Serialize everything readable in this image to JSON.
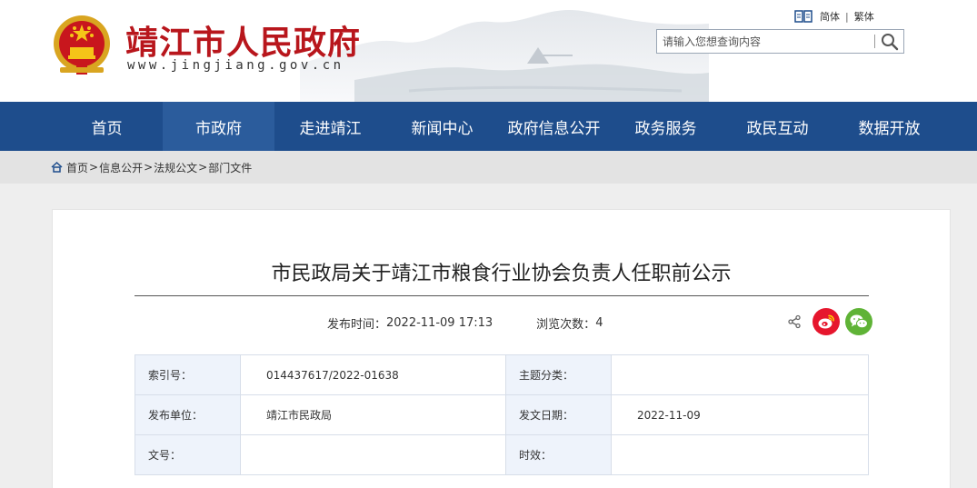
{
  "header": {
    "site_title": "靖江市人民政府",
    "site_url": "www.jingjiang.gov.cn",
    "lang_simplified": "简体",
    "lang_separator": "|",
    "lang_traditional": "繁体",
    "search_placeholder": "请输入您想查询内容"
  },
  "nav": {
    "items": [
      "首页",
      "市政府",
      "走进靖江",
      "新闻中心",
      "政府信息公开",
      "政务服务",
      "政民互动",
      "数据开放"
    ],
    "active_index": 1
  },
  "breadcrumb": {
    "items": [
      "首页",
      "信息公开",
      "法规公文",
      "部门文件"
    ],
    "separator": ">"
  },
  "article": {
    "title": "市民政局关于靖江市粮食行业协会负责人任职前公示",
    "publish_label": "发布时间：",
    "publish_time": "2022-11-09 17:13",
    "views_label": "浏览次数：",
    "views": "4"
  },
  "info_table": {
    "index_label": "索引号：",
    "index_value": "014437617/2022-01638",
    "topic_label": "主题分类：",
    "topic_value": "",
    "unit_label": "发布单位：",
    "unit_value": "靖江市民政局",
    "date_label": "发文日期：",
    "date_value": "2022-11-09",
    "docno_label": "文号：",
    "docno_value": "",
    "validity_label": "时效：",
    "validity_value": ""
  },
  "colors": {
    "brand_red": "#b8161c",
    "nav_blue": "#1e4d8c",
    "nav_active": "#2b5c9c",
    "weibo_red": "#e6162d",
    "wechat_green": "#5fb336"
  },
  "icons": {
    "emblem": "national-emblem-icon",
    "lang": "book-icon",
    "search": "search-icon",
    "home": "home-icon",
    "share": "share-icon",
    "weibo": "weibo-icon",
    "wechat": "wechat-icon"
  }
}
